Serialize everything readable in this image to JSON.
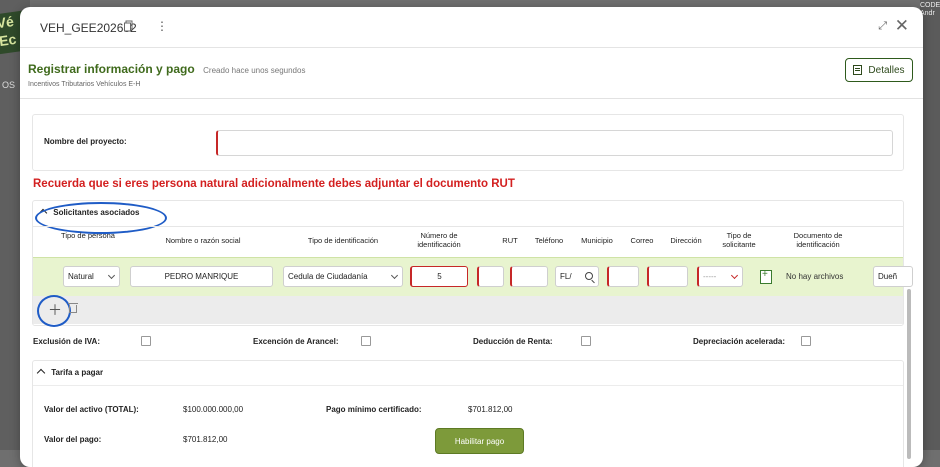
{
  "modal": {
    "record_id": "VEH_GEE202682",
    "title": "Registrar información y pago",
    "created": "Creado hace unos segundos",
    "subtitle": "Incentivos Tributarios Vehículos E-H",
    "details_button": "Detalles"
  },
  "project": {
    "label": "Nombre del proyecto:",
    "value": ""
  },
  "warning": "Recuerda que si eres persona natural adicionalmente debes adjuntar el documento RUT",
  "solicitantes": {
    "toggle_label": "Solicitantes asociados",
    "columns": {
      "tipo_persona": "Tipo de persona",
      "nombre": "Nombre o razón social",
      "tipo_ident": "Tipo de identificación",
      "numero": "Número de identificación",
      "rut": "RUT",
      "telefono": "Teléfono",
      "municipio": "Municipio",
      "correo": "Correo",
      "direccion": "Dirección",
      "tipo_solicitante": "Tipo de solicitante",
      "documento": "Documento de identificación"
    },
    "row": {
      "tipo_persona": "Natural",
      "nombre": "PEDRO MANRIQUE",
      "tipo_ident": "Cedula de Ciudadanía",
      "numero": "5",
      "municipio": "FL/",
      "tipo_solicitante": "-----",
      "no_files": "No hay archivos",
      "extra": "Dueñ"
    }
  },
  "options": {
    "iva": "Exclusión de IVA:",
    "arancel": "Excención de Arancel:",
    "renta": "Deducción de Renta:",
    "depreciacion": "Depreciación acelerada:"
  },
  "tarifa": {
    "toggle_label": "Tarifa a pagar",
    "valor_activo_label": "Valor del activo (TOTAL):",
    "valor_activo": "$100.000.000,00",
    "pago_minimo_label": "Pago mínimo certificado:",
    "pago_minimo": "$701.812,00",
    "valor_pago_label": "Valor del pago:",
    "valor_pago": "$701.812,00",
    "habilitar_button": "Habilitar pago"
  },
  "background": {
    "logo": "Vé\nEc",
    "left_text": "OS",
    "right_text": "CODEN\nAndr"
  }
}
